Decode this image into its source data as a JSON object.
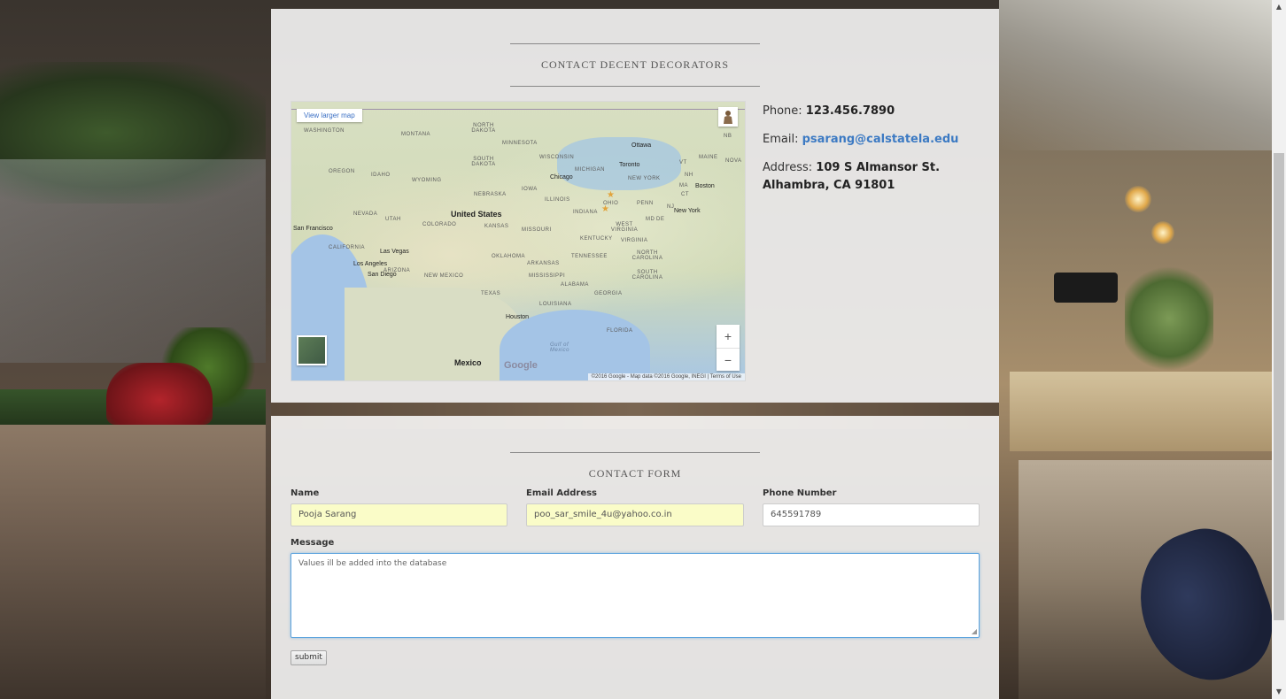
{
  "contact_section": {
    "title": "CONTACT DECENT DECORATORS",
    "map": {
      "view_larger_label": "View larger map",
      "country_label": "United States",
      "mexico_label": "Mexico",
      "gulf_label": "Gulf of Mexico",
      "gulf_label_line1": "Gulf of",
      "gulf_label_line2": "Mexico",
      "google_label": "Google",
      "footer_text": "©2016 Google - Map data ©2016 Google, INEGI | Terms of Use",
      "zoom_in": "+",
      "zoom_out": "−",
      "states": [
        "WASHINGTON",
        "MONTANA",
        "NORTH DAKOTA",
        "MINNESOTA",
        "SOUTH DAKOTA",
        "WISCONSIN",
        "MICHIGAN",
        "OREGON",
        "IDAHO",
        "WYOMING",
        "NEBRASKA",
        "IOWA",
        "ILLINOIS",
        "INDIANA",
        "OHIO",
        "PENN",
        "NEVADA",
        "UTAH",
        "COLORADO",
        "KANSAS",
        "MISSOURI",
        "KENTUCKY",
        "WEST VIRGINIA",
        "VIRGINIA",
        "CALIFORNIA",
        "ARIZONA",
        "NEW MEXICO",
        "OKLAHOMA",
        "ARKANSAS",
        "TENNESSEE",
        "NORTH CAROLINA",
        "SOUTH CAROLINA",
        "MISSISSIPPI",
        "ALABAMA",
        "GEORGIA",
        "TEXAS",
        "LOUISIANA",
        "FLORIDA",
        "NEW YORK",
        "MAINE",
        "NOVA",
        "VT",
        "NH",
        "MA",
        "CT",
        "NB",
        "NJ",
        "MD",
        "DE"
      ],
      "cities": [
        "San Francisco",
        "Las Vegas",
        "Los Angeles",
        "San Diego",
        "Chicago",
        "Toronto",
        "Ottawa",
        "Boston",
        "New York",
        "Houston"
      ]
    },
    "info": {
      "phone_label": "Phone:",
      "phone_value": "123.456.7890",
      "email_label": "Email:",
      "email_value": "psarang@calstatela.edu",
      "address_label": "Address:",
      "address_line1": "109 S Almansor St.",
      "address_line2": "Alhambra, CA 91801"
    }
  },
  "form_section": {
    "title": "CONTACT FORM",
    "name_label": "Name",
    "name_value": "Pooja Sarang",
    "email_label": "Email Address",
    "email_value": "poo_sar_smile_4u@yahoo.co.in",
    "phone_label": "Phone Number",
    "phone_value": "645591789",
    "message_label": "Message",
    "message_value": "Values ill be added into the database",
    "submit_label": "submit"
  },
  "scrollbar": {
    "up_glyph": "▲",
    "down_glyph": "▼"
  },
  "colors": {
    "link_blue": "#3c7ac3",
    "autofill_yellow": "#fafcc8",
    "focus_blue": "#5da4de"
  }
}
